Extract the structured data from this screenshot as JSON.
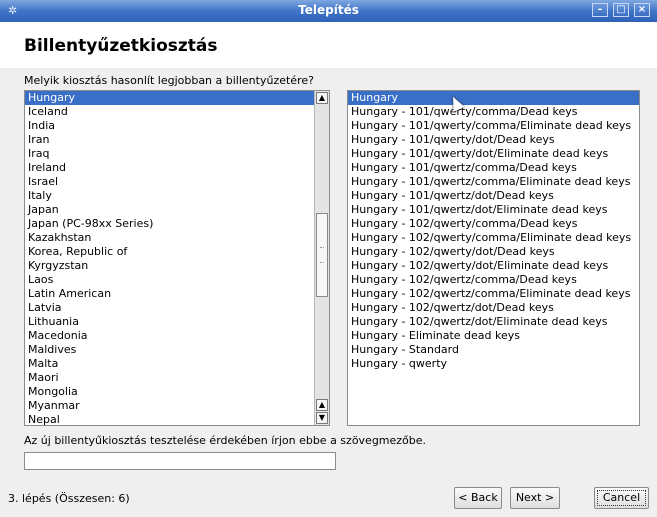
{
  "window": {
    "title": "Telepítés"
  },
  "header": {
    "title": "Billentyűzetkiosztás"
  },
  "prompt": "Melyik kiosztás hasonlít legjobban a billentyűzetére?",
  "countries": {
    "selected_index": 0,
    "items": [
      "Hungary",
      "Iceland",
      "India",
      "Iran",
      "Iraq",
      "Ireland",
      "Israel",
      "Italy",
      "Japan",
      "Japan (PC-98xx Series)",
      "Kazakhstan",
      "Korea, Republic of",
      "Kyrgyzstan",
      "Laos",
      "Latin American",
      "Latvia",
      "Lithuania",
      "Macedonia",
      "Maldives",
      "Malta",
      "Maori",
      "Mongolia",
      "Myanmar",
      "Nepal"
    ]
  },
  "layouts": {
    "selected_index": 0,
    "items": [
      "Hungary",
      "Hungary - 101/qwerty/comma/Dead keys",
      "Hungary - 101/qwerty/comma/Eliminate dead keys",
      "Hungary - 101/qwerty/dot/Dead keys",
      "Hungary - 101/qwerty/dot/Eliminate dead keys",
      "Hungary - 101/qwertz/comma/Dead keys",
      "Hungary - 101/qwertz/comma/Eliminate dead keys",
      "Hungary - 101/qwertz/dot/Dead keys",
      "Hungary - 101/qwertz/dot/Eliminate dead keys",
      "Hungary - 102/qwerty/comma/Dead keys",
      "Hungary - 102/qwerty/comma/Eliminate dead keys",
      "Hungary - 102/qwerty/dot/Dead keys",
      "Hungary - 102/qwerty/dot/Eliminate dead keys",
      "Hungary - 102/qwertz/comma/Dead keys",
      "Hungary - 102/qwertz/comma/Eliminate dead keys",
      "Hungary - 102/qwertz/dot/Dead keys",
      "Hungary - 102/qwertz/dot/Eliminate dead keys",
      "Hungary - Eliminate dead keys",
      "Hungary - Standard",
      "Hungary - qwerty"
    ]
  },
  "test": {
    "label": "Az új billentyűkiosztás tesztelése érdekében írjon ebbe a szövegmezőbe.",
    "value": ""
  },
  "footer": {
    "step": "3. lépés (Összesen: 6)",
    "back": "< Back",
    "next": "Next >",
    "cancel": "Cancel"
  },
  "colors": {
    "titlebar": "#3f74c8",
    "selection": "#3a6fc7"
  }
}
